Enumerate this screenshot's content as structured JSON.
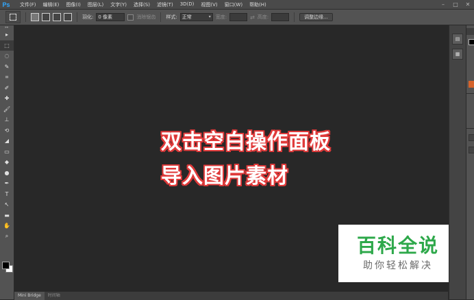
{
  "app": {
    "logo": "Ps"
  },
  "menu": [
    "文件(F)",
    "编辑(E)",
    "图像(I)",
    "图层(L)",
    "文字(Y)",
    "选择(S)",
    "滤镜(T)",
    "3D(D)",
    "视图(V)",
    "窗口(W)",
    "帮助(H)"
  ],
  "window_controls": {
    "minimize": "–",
    "maximize": "□",
    "close": "✕"
  },
  "options": {
    "feather_label": "羽化:",
    "feather_value": "0 像素",
    "antialias_label": "消除锯齿",
    "style_label": "样式:",
    "style_value": "正常",
    "width_label": "宽度:",
    "height_label": "高度:",
    "swap_icon": "⇄",
    "refine_edge": "调整边缘..."
  },
  "tools": [
    "▸",
    "⬚",
    "◌",
    "✎",
    "⌗",
    "✐",
    "✚",
    "🖌",
    "⊥",
    "⟲",
    "◢",
    "▭",
    "◆",
    "●",
    "✒",
    "T",
    "↖",
    "▬",
    "✋",
    "⌕"
  ],
  "caption": {
    "line1": "双击空白操作面板",
    "line2": "导入图片素材"
  },
  "watermark": {
    "title": "百科全说",
    "subtitle": "助你轻松解决"
  },
  "bottom_tabs": [
    "Mini Bridge",
    "时间轴"
  ],
  "colors": {
    "caption_stroke": "#e03a3a",
    "watermark_green": "#2da84a",
    "ps_blue": "#31a8ff"
  }
}
